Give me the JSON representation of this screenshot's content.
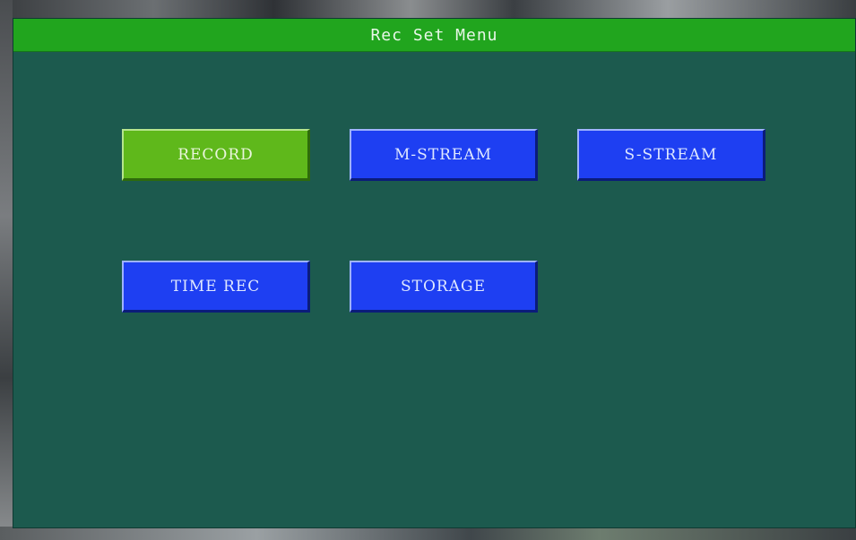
{
  "title": "Rec Set Menu",
  "buttons": {
    "record": "RECORD",
    "m_stream": "M-STREAM",
    "s_stream": "S-STREAM",
    "time_rec": "TIME REC",
    "storage": "STORAGE"
  },
  "selected": "RECORD",
  "colors": {
    "title_bar": "#21a51e",
    "panel": "#1c5a4e",
    "button": "#1e3ff2",
    "button_selected": "#5fb81b"
  }
}
